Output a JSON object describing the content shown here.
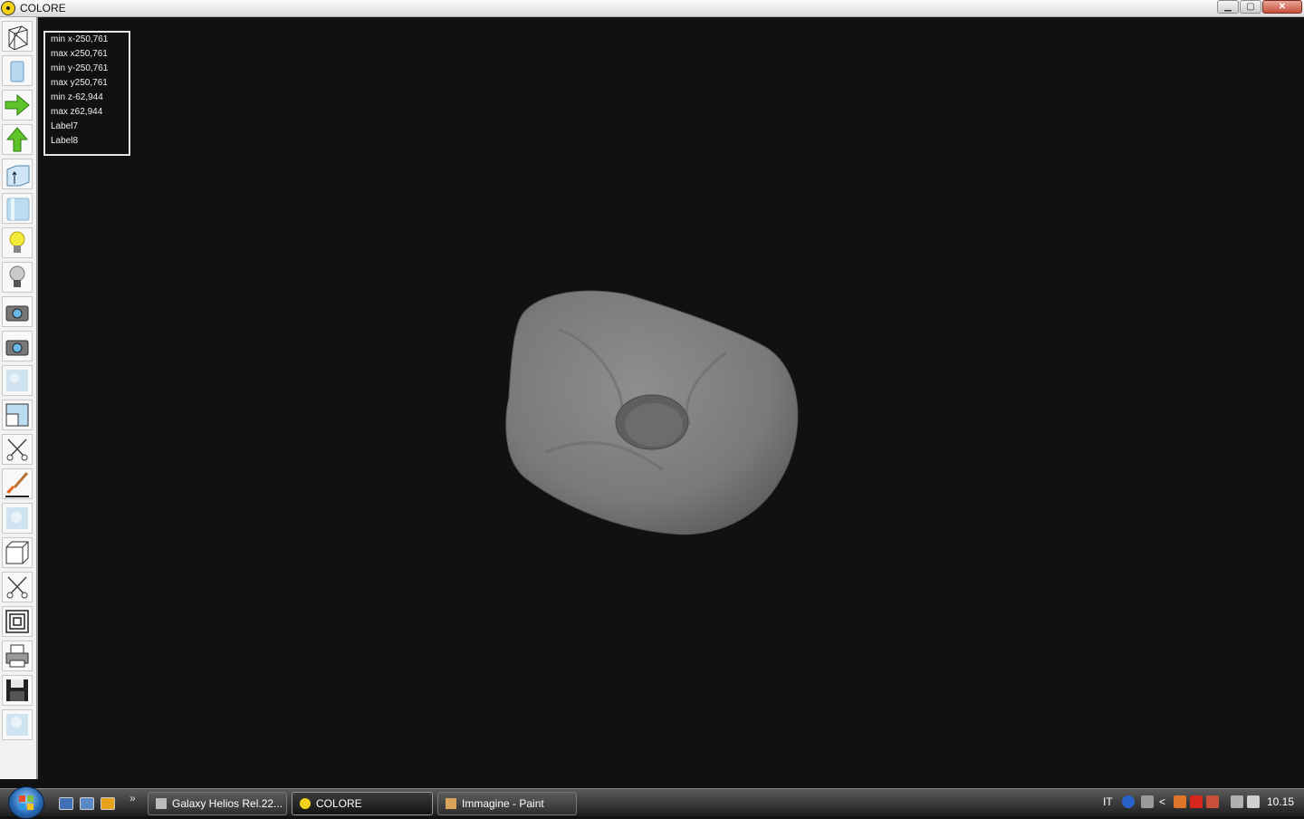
{
  "window": {
    "title": "COLORE",
    "controls": {
      "minimize": "▁",
      "maximize": "▢",
      "close": "✕"
    }
  },
  "toolbar": {
    "tools": [
      "wireframe-tool-icon",
      "solid-view-icon",
      "arrow-right-icon",
      "arrow-up-icon",
      "normal-tool-icon",
      "cylinder-icon",
      "light-on-icon",
      "light-off-icon",
      "camera-icon",
      "camera-2-icon",
      "texture-icon",
      "window-split-icon",
      "scissors-icon",
      "paint-brush-icon",
      "texture-2-icon",
      "cube-icon",
      "scissors-2-icon",
      "nested-squares-icon",
      "printer-icon",
      "save-disk-icon",
      "texture-3-icon"
    ]
  },
  "info": {
    "min_x": "min x-250,761",
    "max_x": "max x250,761",
    "min_y": "min y-250,761",
    "max_y": "max y250,761",
    "min_z": "min z-62,944",
    "max_z": "max z62,944",
    "label7": "Label7",
    "label8": "Label8"
  },
  "taskbar": {
    "tasks": [
      {
        "label": "Galaxy Helios  Rel.22..."
      },
      {
        "label": "COLORE"
      },
      {
        "label": "Immagine - Paint"
      }
    ],
    "quicklaunch_more": "»",
    "language": "IT",
    "clock": "10.15",
    "tray_arrow": "<"
  },
  "colors": {
    "background": "#111111",
    "model": "#7d7d7d",
    "titlebar": "#e6e6e6"
  }
}
